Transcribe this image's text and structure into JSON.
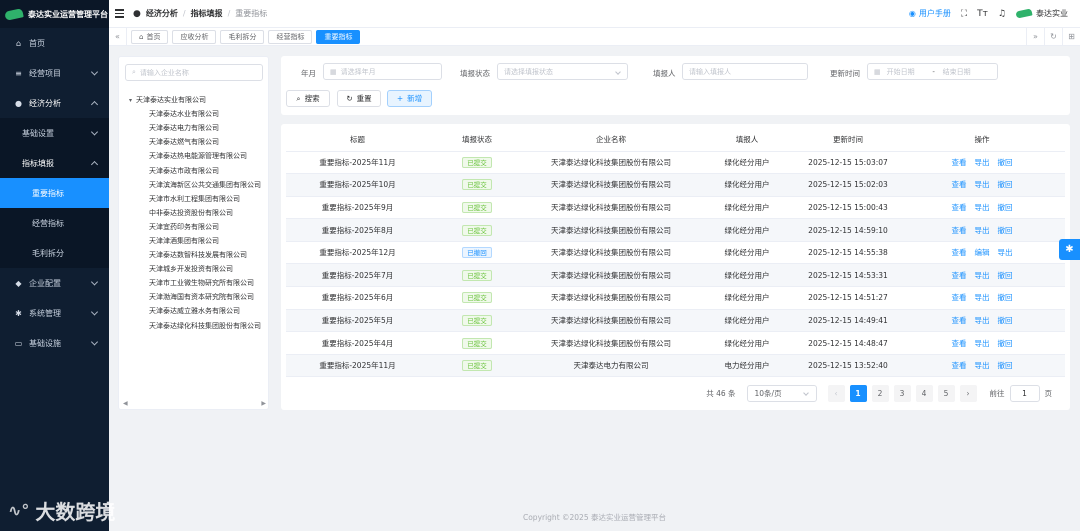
{
  "app": {
    "title": "泰达实业运营管理平台"
  },
  "sidebar": {
    "items": [
      {
        "label": "首页",
        "icon": "home-icon"
      },
      {
        "label": "经营项目",
        "icon": "sliders-icon"
      },
      {
        "label": "经济分析",
        "icon": "chat-icon"
      },
      {
        "label": "基础设置"
      },
      {
        "label": "指标填报"
      },
      {
        "label": "重要指标"
      },
      {
        "label": "经营指标"
      },
      {
        "label": "毛利拆分"
      },
      {
        "label": "企业配置",
        "icon": "cube-icon"
      },
      {
        "label": "系统管理",
        "icon": "gear-icon"
      },
      {
        "label": "基础设施",
        "icon": "monitor-icon"
      }
    ]
  },
  "header": {
    "breadcrumb": [
      "经济分析",
      "指标填报",
      "重要指标"
    ],
    "manual": "用户手册",
    "user": "泰达实业"
  },
  "tabs": [
    "首页",
    "应收分析",
    "毛利拆分",
    "经营指标",
    "重要指标"
  ],
  "tree": {
    "search_placeholder": "请输入企业名称",
    "root": "天津泰达实业有限公司",
    "children": [
      "天津泰达水业有限公司",
      "天津泰达电力有限公司",
      "天津泰达燃气有限公司",
      "天津泰达热电能源管理有限公司",
      "天津泰达市政有限公司",
      "天津滨海新区公共交通集团有限公司",
      "天津市水利工程集团有限公司",
      "中非泰达投资股份有限公司",
      "天津宜药印务有限公司",
      "天津津酒集团有限公司",
      "天津泰达数智科技发展有限公司",
      "天津城乡开发投资有限公司",
      "天津市工业微生物研究所有限公司",
      "天津渤海国有资本研究院有限公司",
      "天津泰达威立雅水务有限公司",
      "天津泰达绿化科技集团股份有限公司"
    ]
  },
  "filters": {
    "month_label": "年月",
    "month_placeholder": "请选择年月",
    "status_label": "填报状态",
    "status_placeholder": "请选择填报状态",
    "reporter_label": "填报人",
    "reporter_placeholder": "请输入填报人",
    "updated_label": "更新时间",
    "start_placeholder": "开始日期",
    "range_sep": "-",
    "end_placeholder": "结束日期",
    "search_btn": "搜索",
    "reset_btn": "重置",
    "add_btn": "新增"
  },
  "table": {
    "headers": [
      "标题",
      "填报状态",
      "企业名称",
      "填报人",
      "更新时间",
      "操作"
    ],
    "rows": [
      {
        "title": "重要指标-2025年11月",
        "status": "已提交",
        "company": "天津泰达绿化科技集团股份有限公司",
        "reporter": "绿化经分用户",
        "updated": "2025-12-15 15:03:07",
        "ops": [
          "查看",
          "导出",
          "撤回"
        ]
      },
      {
        "title": "重要指标-2025年10月",
        "status": "已提交",
        "company": "天津泰达绿化科技集团股份有限公司",
        "reporter": "绿化经分用户",
        "updated": "2025-12-15 15:02:03",
        "ops": [
          "查看",
          "导出",
          "撤回"
        ]
      },
      {
        "title": "重要指标-2025年9月",
        "status": "已提交",
        "company": "天津泰达绿化科技集团股份有限公司",
        "reporter": "绿化经分用户",
        "updated": "2025-12-15 15:00:43",
        "ops": [
          "查看",
          "导出",
          "撤回"
        ]
      },
      {
        "title": "重要指标-2025年8月",
        "status": "已提交",
        "company": "天津泰达绿化科技集团股份有限公司",
        "reporter": "绿化经分用户",
        "updated": "2025-12-15 14:59:10",
        "ops": [
          "查看",
          "导出",
          "撤回"
        ]
      },
      {
        "title": "重要指标-2025年12月",
        "status": "已撤回",
        "company": "天津泰达绿化科技集团股份有限公司",
        "reporter": "绿化经分用户",
        "updated": "2025-12-15 14:55:38",
        "ops": [
          "查看",
          "编辑",
          "导出"
        ]
      },
      {
        "title": "重要指标-2025年7月",
        "status": "已提交",
        "company": "天津泰达绿化科技集团股份有限公司",
        "reporter": "绿化经分用户",
        "updated": "2025-12-15 14:53:31",
        "ops": [
          "查看",
          "导出",
          "撤回"
        ]
      },
      {
        "title": "重要指标-2025年6月",
        "status": "已提交",
        "company": "天津泰达绿化科技集团股份有限公司",
        "reporter": "绿化经分用户",
        "updated": "2025-12-15 14:51:27",
        "ops": [
          "查看",
          "导出",
          "撤回"
        ]
      },
      {
        "title": "重要指标-2025年5月",
        "status": "已提交",
        "company": "天津泰达绿化科技集团股份有限公司",
        "reporter": "绿化经分用户",
        "updated": "2025-12-15 14:49:41",
        "ops": [
          "查看",
          "导出",
          "撤回"
        ]
      },
      {
        "title": "重要指标-2025年4月",
        "status": "已提交",
        "company": "天津泰达绿化科技集团股份有限公司",
        "reporter": "绿化经分用户",
        "updated": "2025-12-15 14:48:47",
        "ops": [
          "查看",
          "导出",
          "撤回"
        ]
      },
      {
        "title": "重要指标-2025年11月",
        "status": "已提交",
        "company": "天津泰达电力有限公司",
        "reporter": "电力经分用户",
        "updated": "2025-12-15 13:52:40",
        "ops": [
          "查看",
          "导出",
          "撤回"
        ]
      }
    ]
  },
  "pagination": {
    "total": "共 46 条",
    "page_size": "10条/页",
    "pages": [
      "1",
      "2",
      "3",
      "4",
      "5"
    ],
    "current": "1",
    "goto_label": "前往",
    "goto_value": "1",
    "goto_suffix": "页"
  },
  "footer": "Copyright ©2025 泰达实业运营管理平台",
  "watermark": "大数跨境",
  "colors": {
    "primary": "#1890ff",
    "sidebar": "#0f1e31",
    "success": "#67c23a",
    "brand_green": "#2fb26b"
  }
}
